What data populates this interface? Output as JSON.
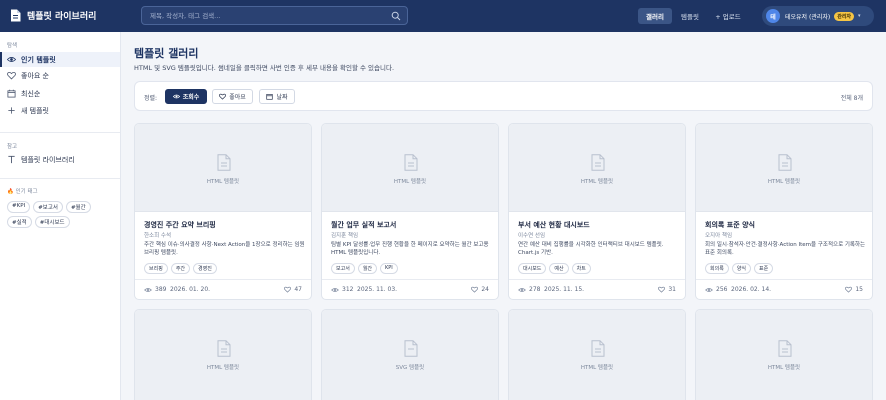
{
  "app": {
    "title": "템플릿 라이브러리"
  },
  "search": {
    "placeholder": "제목, 작성자, 태그 검색..."
  },
  "nav": {
    "gallery": "갤러리",
    "templates": "템플릿",
    "upload": "+ 업로드"
  },
  "user": {
    "avatar": "테",
    "name": "테오유저 (관리자)",
    "badge": "관리자"
  },
  "sidebar": {
    "explore_label": "탐색",
    "items": [
      {
        "label": "인기 템플릿"
      },
      {
        "label": "좋아요 순"
      },
      {
        "label": "최신순"
      },
      {
        "label": "새 템플릿"
      }
    ],
    "ref_label": "참고",
    "ref_items": [
      {
        "label": "템플릿 라이브러리"
      }
    ],
    "tags_label": "🔥 인기 태그",
    "tags": [
      "#KPI",
      "#보고서",
      "#월간",
      "#실적",
      "#대시보드"
    ]
  },
  "main": {
    "title": "템플릿 갤러리",
    "subtitle": "HTML 및 SVG 템플릿입니다. 썸네일을 클릭하면 사번 인증 후 세부 내용을 확인할 수 있습니다.",
    "sort_label": "정렬:",
    "sort_options": [
      "조회수",
      "좋아요",
      "날짜"
    ],
    "total": "전체 8개"
  },
  "cards": [
    {
      "thumb": "HTML 템플릿",
      "title": "경영진 주간 요약 브리핑",
      "author": "한소희 수석",
      "desc": "주간 핵심 이슈·의사결정 사항·Next Action을 1장으로 정리하는 임원 브리핑 템플릿.",
      "tags": [
        "브리핑",
        "주간",
        "경영진"
      ],
      "views": "389",
      "date": "2026. 01. 20.",
      "likes": "47"
    },
    {
      "thumb": "HTML 템플릿",
      "title": "월간 업무 실적 보고서",
      "author": "김지훈 책임",
      "desc": "팀별 KPI 달성률·업무 진행 현황을 한 페이지로 요약하는 월간 보고용 HTML 템플릿입니다.",
      "tags": [
        "보고서",
        "월간",
        "KPI"
      ],
      "views": "312",
      "date": "2025. 11. 03.",
      "likes": "24"
    },
    {
      "thumb": "HTML 템플릿",
      "title": "부서 예산 현황 대시보드",
      "author": "이수연 선임",
      "desc": "연간 예산 대비 집행률을 시각화한 인터랙티브 대시보드 템플릿. Chart.js 기반.",
      "tags": [
        "대시보드",
        "예산",
        "차트"
      ],
      "views": "278",
      "date": "2025. 11. 15.",
      "likes": "31"
    },
    {
      "thumb": "HTML 템플릿",
      "title": "회의록 표준 양식",
      "author": "오지아 책임",
      "desc": "회의 일시·참석자·안건·결정사항·Action Item을 구조적으로 기록하는 표준 회의록.",
      "tags": [
        "회의록",
        "양식",
        "표준"
      ],
      "views": "256",
      "date": "2026. 02. 14.",
      "likes": "15"
    },
    {
      "thumb": "HTML 템플릿"
    },
    {
      "thumb": "SVG 템플릿"
    },
    {
      "thumb": "HTML 템플릿"
    },
    {
      "thumb": "HTML 템플릿"
    }
  ]
}
